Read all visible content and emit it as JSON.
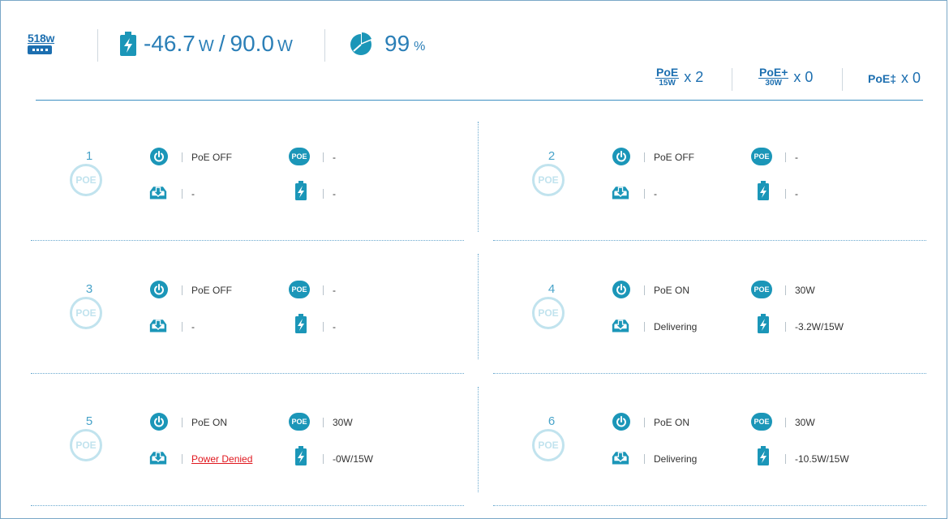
{
  "header": {
    "model": "518w",
    "power_used": "-46.7",
    "power_unit_used": "W",
    "power_separator": "/",
    "power_budget": "90.0",
    "power_unit_budget": "W",
    "usage_percent": "99",
    "usage_unit": "%",
    "legend": [
      {
        "label": "PoE",
        "sub": "15W",
        "count": "x 2"
      },
      {
        "label": "PoE+",
        "sub": "30W",
        "count": "x 0"
      },
      {
        "label": "PoE‡",
        "count": "x 0"
      }
    ]
  },
  "colors": {
    "accent": "#1b96b8",
    "brand": "#1d6fb0",
    "denied": "#e0171e"
  },
  "ports": [
    {
      "number": "1",
      "badge": "POE",
      "state": "PoE OFF",
      "class": "-",
      "status": "-",
      "power": "-",
      "denied": false
    },
    {
      "number": "2",
      "badge": "POE",
      "state": "PoE OFF",
      "class": "-",
      "status": "-",
      "power": "-",
      "denied": false
    },
    {
      "number": "3",
      "badge": "POE",
      "state": "PoE OFF",
      "class": "-",
      "status": "-",
      "power": "-",
      "denied": false
    },
    {
      "number": "4",
      "badge": "POE",
      "state": "PoE ON",
      "class": "30W",
      "status": "Delivering",
      "power": "-3.2W/15W",
      "denied": false
    },
    {
      "number": "5",
      "badge": "POE",
      "state": "PoE ON",
      "class": "30W",
      "status": "Power Denied",
      "power": "-0W/15W",
      "denied": true
    },
    {
      "number": "6",
      "badge": "POE",
      "state": "PoE ON",
      "class": "30W",
      "status": "Delivering",
      "power": "-10.5W/15W",
      "denied": false
    }
  ],
  "icons": {
    "switch": "switch-icon",
    "battery": "battery-bolt-icon",
    "pie": "pie-chart-icon",
    "power": "power-icon",
    "poe": "poe-icon",
    "deliver": "download-tray-icon"
  }
}
